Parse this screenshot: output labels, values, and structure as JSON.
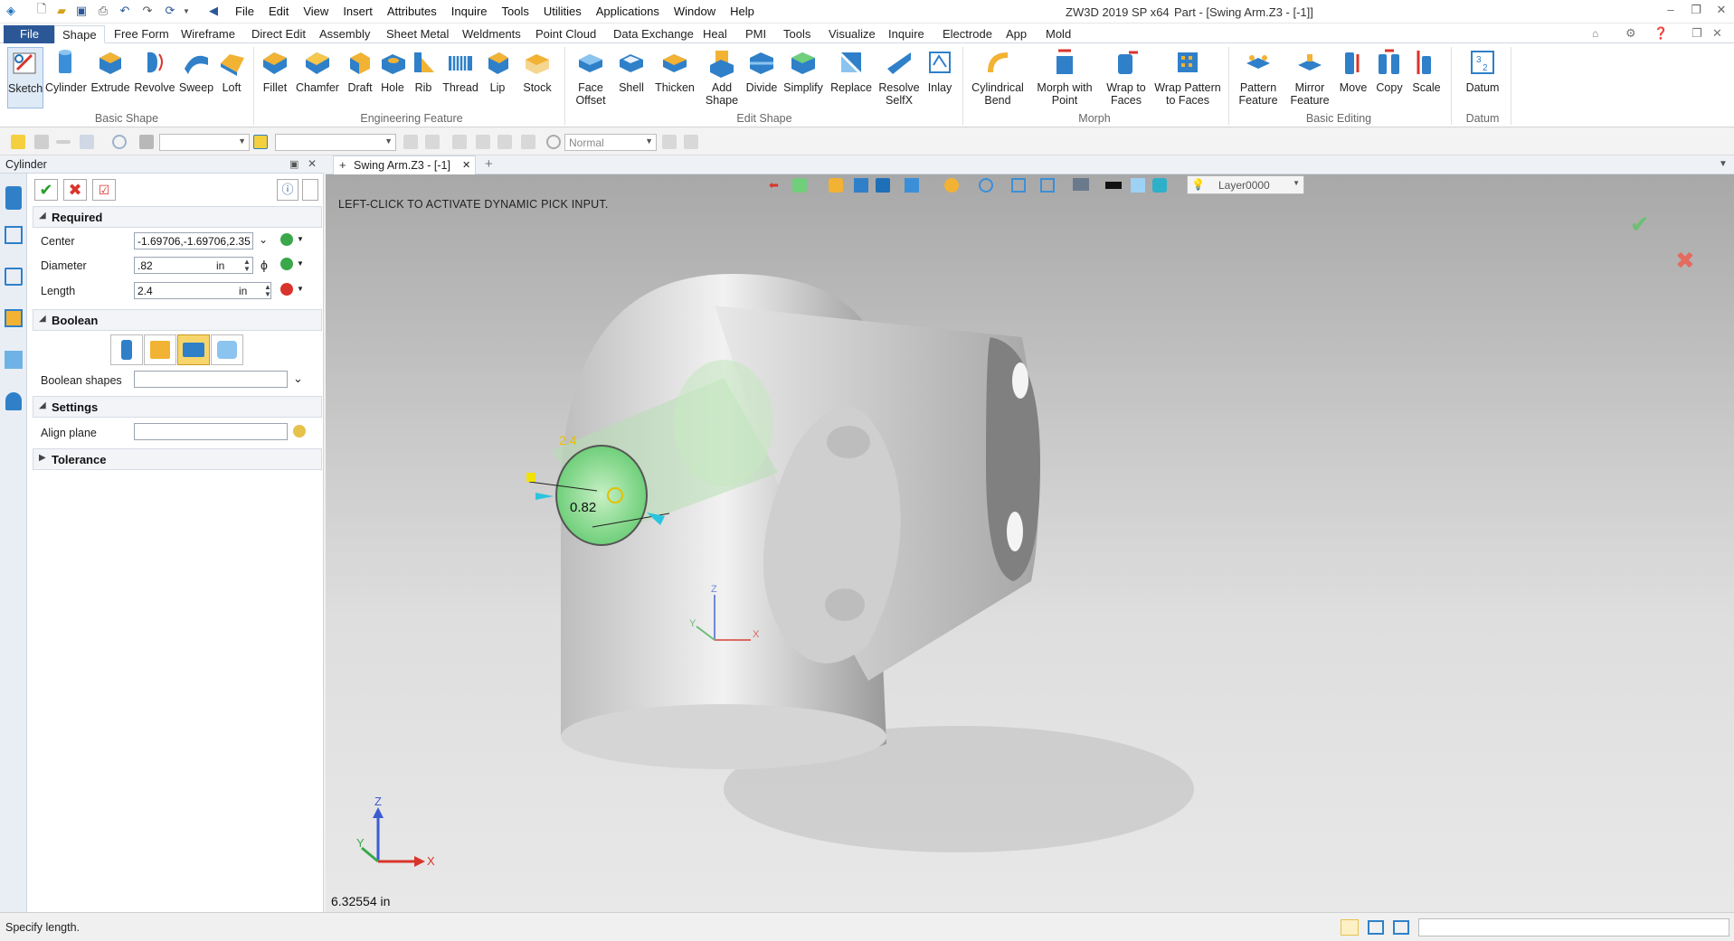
{
  "app": {
    "name": "ZW3D 2019 SP x64",
    "document": "Part - [Swing Arm.Z3 - [-1]]"
  },
  "menu": [
    "File",
    "Edit",
    "View",
    "Insert",
    "Attributes",
    "Inquire",
    "Tools",
    "Utilities",
    "Applications",
    "Window",
    "Help"
  ],
  "ribbon_tabs": [
    "File",
    "Shape",
    "Free Form",
    "Wireframe",
    "Direct Edit",
    "Assembly",
    "Sheet Metal",
    "Weldments",
    "Point Cloud",
    "Data Exchange",
    "Heal",
    "PMI",
    "Tools",
    "Visualize",
    "Inquire",
    "Electrode",
    "App",
    "Mold"
  ],
  "ribbon": {
    "basic_shape": {
      "label": "Basic Shape",
      "buttons": [
        "Sketch",
        "Cylinder",
        "Extrude",
        "Revolve",
        "Sweep",
        "Loft"
      ]
    },
    "engineering_feature": {
      "label": "Engineering Feature",
      "buttons": [
        "Fillet",
        "Chamfer",
        "Draft",
        "Hole",
        "Rib",
        "Thread",
        "Lip",
        "Stock"
      ]
    },
    "edit_shape": {
      "label": "Edit Shape",
      "buttons": [
        "Face Offset",
        "Shell",
        "Thicken",
        "Add Shape",
        "Divide",
        "Simplify",
        "Replace",
        "Resolve SelfX",
        "Inlay"
      ]
    },
    "morph": {
      "label": "Morph",
      "buttons": [
        "Cylindrical Bend",
        "Morph with Point",
        "Wrap to Faces",
        "Wrap Pattern to Faces"
      ]
    },
    "basic_editing": {
      "label": "Basic Editing",
      "buttons": [
        "Pattern Feature",
        "Mirror Feature",
        "Move",
        "Copy",
        "Scale"
      ]
    },
    "datum": {
      "label": "Datum",
      "buttons": [
        "Datum"
      ]
    }
  },
  "toolbar2": {
    "mode_combo": "Normal"
  },
  "panel": {
    "title": "Cylinder",
    "required": {
      "label": "Required",
      "center_label": "Center",
      "center_value": "-1.69706,-1.69706,2.35",
      "diameter_label": "Diameter",
      "diameter_value": ".82",
      "diameter_unit": "in",
      "length_label": "Length",
      "length_value": "2.4",
      "length_unit": "in"
    },
    "boolean": {
      "label": "Boolean",
      "shapes_label": "Boolean shapes"
    },
    "settings": {
      "label": "Settings",
      "align_plane_label": "Align plane"
    },
    "tolerance": {
      "label": "Tolerance"
    }
  },
  "doc_tab": "Swing Arm.Z3 - [-1]",
  "viewport": {
    "hint": "LEFT-CLICK TO ACTIVATE DYNAMIC PICK INPUT.",
    "layer": "Layer0000",
    "dim_diameter": "0.82",
    "dim_length": "2.4",
    "readout": "6.32554 in",
    "axes": {
      "x": "X",
      "y": "Y",
      "z": "Z"
    }
  },
  "status": "Specify length.",
  "colors": {
    "file_tab": "#2b5797",
    "preview_green": "#7fd68a",
    "accent_blue": "#1f6fb8"
  }
}
